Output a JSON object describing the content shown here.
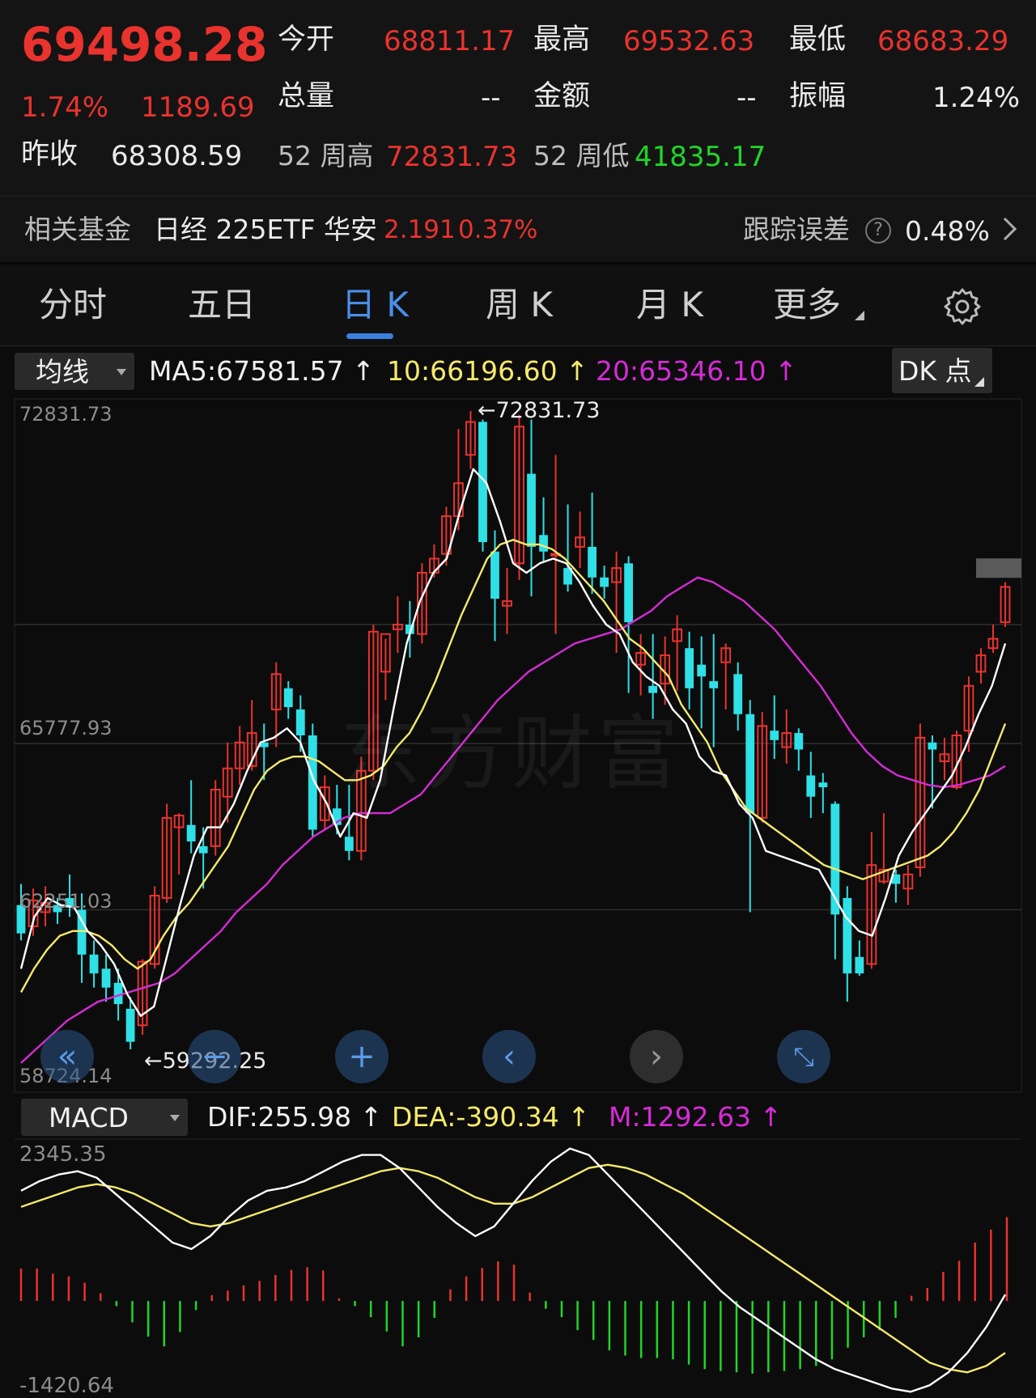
{
  "quote": {
    "price": "69498.28",
    "change_pct": "1.74%",
    "change_amt": "1189.69",
    "open_label": "今开",
    "open": "68811.17",
    "high_label": "最高",
    "high": "69532.63",
    "low_label": "最低",
    "low": "68683.29",
    "volume_label": "总量",
    "volume": "--",
    "amount_label": "金额",
    "amount": "--",
    "amplitude_label": "振幅",
    "amplitude": "1.24%",
    "prev_close_label": "昨收",
    "prev_close": "68308.59",
    "w52_high_label": "52 周高",
    "w52_high": "72831.73",
    "w52_low_label": "52 周低",
    "w52_low": "41835.17"
  },
  "fund": {
    "label": "相关基金",
    "name": "日经 225ETF 华安",
    "price": "2.191",
    "change": "0.37%",
    "tracking_label": "跟踪误差",
    "tracking_value": "0.48%"
  },
  "tabs": {
    "items": [
      "分时",
      "五日",
      "日 K",
      "周 K",
      "月 K",
      "更多"
    ],
    "active": 2
  },
  "kline_legend": {
    "selector": "均线",
    "ma5": "MA5:67581.57",
    "ma10": "10:66196.60",
    "ma20": "20:65346.10",
    "dk_label": "DK 点"
  },
  "macd_legend": {
    "selector": "MACD",
    "dif": "DIF:255.98",
    "dea": "DEA:-390.34",
    "m": "M:1292.63"
  },
  "colors": {
    "up": "#e8332e",
    "down": "#2fe0e6",
    "ma5": "#ffffff",
    "ma10": "#f5e96b",
    "ma20": "#d62bd6",
    "macd_up": "#e8332e",
    "macd_down": "#22d42a"
  },
  "chart_data": [
    {
      "type": "candlestick",
      "y_axis_labels": [
        "72831.73",
        "65777.93",
        "62251.03",
        "58724.14"
      ],
      "ylim": [
        58724.14,
        72831.73
      ],
      "max_label": "72831.73",
      "min_label": "59292.25",
      "candles": [
        [
          62350,
          62800,
          61600,
          61750
        ],
        [
          61900,
          62700,
          61700,
          62450
        ],
        [
          62200,
          62750,
          61900,
          62400
        ],
        [
          62350,
          62500,
          61950,
          62200
        ],
        [
          62500,
          63000,
          62100,
          62300
        ],
        [
          62250,
          62600,
          60700,
          61300
        ],
        [
          61300,
          61600,
          60600,
          60900
        ],
        [
          61000,
          61300,
          60300,
          60600
        ],
        [
          60700,
          61000,
          59900,
          60250
        ],
        [
          60150,
          60400,
          59290,
          59450
        ],
        [
          59800,
          61200,
          59600,
          61150
        ],
        [
          61100,
          62750,
          61000,
          62550
        ],
        [
          62500,
          64500,
          62400,
          64200
        ],
        [
          64000,
          64300,
          63000,
          64250
        ],
        [
          64050,
          65000,
          63450,
          63700
        ],
        [
          63600,
          64000,
          62700,
          63450
        ],
        [
          63600,
          65000,
          63400,
          64800
        ],
        [
          64650,
          65800,
          64100,
          65250
        ],
        [
          65250,
          66150,
          64900,
          65800
        ],
        [
          65300,
          66700,
          65200,
          66000
        ],
        [
          65800,
          66200,
          65000,
          65700
        ],
        [
          66500,
          67500,
          65700,
          67250
        ],
        [
          66950,
          67100,
          66300,
          66550
        ],
        [
          66500,
          66800,
          65600,
          65950
        ],
        [
          65950,
          66200,
          63800,
          63950
        ],
        [
          64150,
          65100,
          63950,
          64850
        ],
        [
          64400,
          64900,
          63850,
          64050
        ],
        [
          63800,
          64900,
          63300,
          63500
        ],
        [
          63500,
          65500,
          63300,
          65200
        ],
        [
          65200,
          68300,
          65000,
          68150
        ],
        [
          67300,
          68000,
          66700,
          68100
        ],
        [
          68200,
          68900,
          67700,
          68300
        ],
        [
          68300,
          68800,
          67600,
          68100
        ],
        [
          68100,
          69600,
          67900,
          69400
        ],
        [
          69400,
          70000,
          69300,
          69700
        ],
        [
          69800,
          70800,
          69550,
          70600
        ],
        [
          70600,
          72450,
          70300,
          71300
        ],
        [
          71900,
          72831,
          71600,
          72600
        ],
        [
          72600,
          72650,
          69850,
          70050
        ],
        [
          69850,
          70300,
          67950,
          68850
        ],
        [
          68700,
          69500,
          68100,
          68800
        ],
        [
          69600,
          72750,
          69250,
          72500
        ],
        [
          71500,
          72650,
          68900,
          69950
        ],
        [
          70200,
          71000,
          69650,
          69850
        ],
        [
          69800,
          71900,
          68100,
          69800
        ],
        [
          69500,
          70850,
          69000,
          69150
        ],
        [
          69950,
          70700,
          69500,
          70150
        ],
        [
          69950,
          71100,
          68950,
          69300
        ],
        [
          69300,
          69550,
          68850,
          69100
        ],
        [
          69200,
          69850,
          67700,
          69500
        ],
        [
          69600,
          69750,
          66850,
          68350
        ],
        [
          67450,
          68100,
          66800,
          67700
        ],
        [
          67000,
          68100,
          66300,
          66850
        ],
        [
          67050,
          68050,
          66600,
          67650
        ],
        [
          67950,
          68500,
          66900,
          68200
        ],
        [
          67800,
          68150,
          66500,
          66950
        ],
        [
          67450,
          68050,
          66100,
          67200
        ],
        [
          67100,
          68100,
          65700,
          66950
        ],
        [
          67500,
          67900,
          66500,
          67800
        ],
        [
          67250,
          67500,
          66050,
          66400
        ],
        [
          66400,
          66700,
          62200,
          64300
        ],
        [
          64200,
          66450,
          64100,
          66150
        ],
        [
          66050,
          66800,
          65450,
          65850
        ],
        [
          65700,
          66500,
          65350,
          66000
        ],
        [
          66000,
          66100,
          65200,
          65650
        ],
        [
          65100,
          65600,
          64200,
          64650
        ],
        [
          64950,
          65150,
          64300,
          64850
        ],
        [
          64500,
          64550,
          61200,
          62150
        ],
        [
          62500,
          62750,
          60300,
          60900
        ],
        [
          61250,
          61600,
          60850,
          60900
        ],
        [
          61100,
          63900,
          61000,
          63200
        ],
        [
          62850,
          64300,
          62800,
          63100
        ],
        [
          63000,
          63100,
          62400,
          62800
        ],
        [
          62700,
          63200,
          62350,
          63000
        ],
        [
          63150,
          66200,
          62950,
          65900
        ],
        [
          65800,
          65950,
          64400,
          65650
        ],
        [
          65400,
          65900,
          65000,
          65550
        ],
        [
          64850,
          66050,
          64800,
          65950
        ],
        [
          66050,
          67200,
          65600,
          67000
        ],
        [
          67300,
          67800,
          67050,
          67650
        ],
        [
          67800,
          68300,
          67700,
          68000
        ],
        [
          68350,
          69200,
          68250,
          69100
        ]
      ],
      "ma5": [
        61000,
        62100,
        62500,
        62350,
        62300,
        61800,
        61500,
        61100,
        60450,
        60000,
        60200,
        61300,
        62400,
        63400,
        64000,
        64000,
        64500,
        65200,
        65800,
        65900,
        66100,
        65800,
        65000,
        64500,
        63800,
        64300,
        64200,
        65000,
        66500,
        67900,
        68800,
        69400,
        69700,
        70700,
        71600,
        71300,
        70500,
        69600,
        69400,
        69600,
        69700,
        69600,
        69200,
        68700,
        68300,
        68100,
        67500,
        67200,
        67000,
        66500,
        66200,
        65500,
        65200,
        65100,
        64500,
        64200,
        63500,
        63400,
        63300,
        63200,
        63100,
        62600,
        62100,
        61800,
        61700,
        62500,
        63400,
        63900,
        64300,
        64700,
        65100,
        65700,
        66400,
        67000,
        67900
      ],
      "ma10": [
        60500,
        61000,
        61400,
        61700,
        61800,
        61800,
        61700,
        61500,
        61200,
        61000,
        61200,
        61700,
        62100,
        62400,
        62800,
        63200,
        63600,
        64200,
        64800,
        65200,
        65400,
        65500,
        65500,
        65400,
        65200,
        65000,
        65000,
        65100,
        65300,
        65700,
        66000,
        66500,
        67100,
        67800,
        68500,
        69100,
        69700,
        70000,
        70100,
        70000,
        70000,
        69900,
        69700,
        69400,
        69100,
        68800,
        68400,
        68000,
        67800,
        67500,
        67200,
        66600,
        66200,
        65800,
        65200,
        64800,
        64400,
        64200,
        64000,
        63800,
        63600,
        63400,
        63200,
        63100,
        63000,
        62900,
        63000,
        63100,
        63200,
        63300,
        63400,
        63600,
        63900,
        64300,
        64800,
        65500,
        66200
      ],
      "ma20": [
        59000,
        59300,
        59600,
        59900,
        60100,
        60300,
        60400,
        60500,
        60600,
        60700,
        60900,
        61200,
        61500,
        61800,
        62200,
        62500,
        62800,
        63200,
        63500,
        63800,
        64000,
        64200,
        64300,
        64300,
        64300,
        64500,
        64700,
        65100,
        65500,
        65900,
        66300,
        66700,
        67000,
        67300,
        67500,
        67700,
        67900,
        68000,
        68100,
        68200,
        68400,
        68600,
        68900,
        69100,
        69300,
        69200,
        69000,
        68800,
        68500,
        68200,
        67800,
        67400,
        67000,
        66500,
        66000,
        65600,
        65300,
        65100,
        65000,
        64900,
        64850,
        64900,
        65000,
        65100,
        65300
      ],
      "x": "trading days (unlabeled)"
    },
    {
      "type": "macd",
      "y_axis_labels": [
        "2345.35",
        "-1420.64"
      ],
      "ylim": [
        -1420.64,
        2345.35
      ],
      "dif": [
        1700,
        1850,
        1950,
        2000,
        1900,
        1650,
        1400,
        1150,
        900,
        800,
        1000,
        1300,
        1550,
        1700,
        1750,
        1850,
        2000,
        2150,
        2250,
        2250,
        2050,
        1750,
        1450,
        1200,
        1000,
        1150,
        1500,
        1850,
        2150,
        2350,
        2250,
        1950,
        1650,
        1350,
        1050,
        750,
        450,
        150,
        -100,
        -300,
        -500,
        -700,
        -900,
        -1050,
        -1150,
        -1250,
        -1350,
        -1400,
        -1300,
        -1100,
        -800,
        -400,
        100
      ],
      "dea": [
        1450,
        1550,
        1650,
        1750,
        1800,
        1750,
        1650,
        1500,
        1350,
        1200,
        1150,
        1200,
        1300,
        1400,
        1500,
        1600,
        1700,
        1800,
        1900,
        2000,
        2050,
        2000,
        1900,
        1750,
        1600,
        1500,
        1500,
        1600,
        1750,
        1900,
        2050,
        2100,
        2050,
        1950,
        1800,
        1650,
        1450,
        1250,
        1050,
        850,
        650,
        450,
        250,
        50,
        -150,
        -350,
        -550,
        -750,
        -950,
        -1050,
        -1100,
        -1000,
        -800
      ],
      "histogram": [
        500,
        500,
        420,
        380,
        280,
        120,
        -80,
        -330,
        -550,
        -700,
        -480,
        -140,
        90,
        160,
        240,
        310,
        400,
        480,
        520,
        470,
        40,
        -80,
        -250,
        -470,
        -700,
        -560,
        -260,
        180,
        380,
        510,
        610,
        560,
        130,
        -120,
        -250,
        -450,
        -600,
        -760,
        -840,
        -880,
        -880,
        -900,
        -980,
        -1050,
        -1080,
        -1100,
        -1120,
        -1100,
        -1080,
        -1050,
        -1000,
        -900,
        -720,
        -560,
        -450,
        -260,
        80,
        200,
        450,
        620,
        900,
        1100,
        1292
      ]
    }
  ]
}
